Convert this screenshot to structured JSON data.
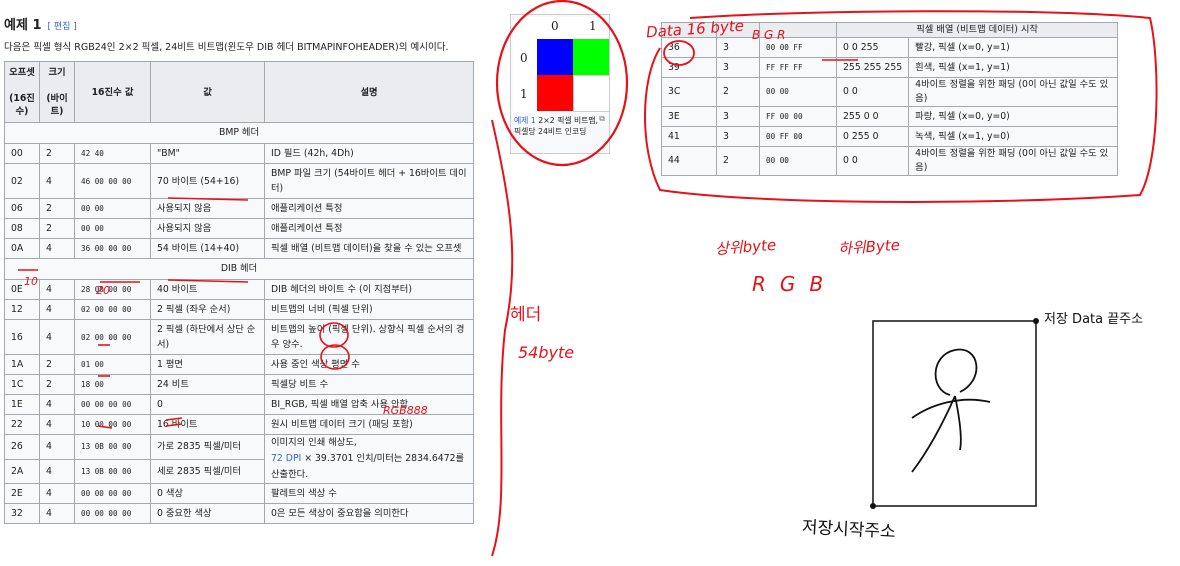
{
  "heading": {
    "title": "예제 1",
    "edit": "[ 편집 ]"
  },
  "intro": "다음은 픽셀 형식 RGB24인 2×2 픽셀, 24비트 비트맵(윈도우 DIB 헤더 BITMAPINFOHEADER)의 예시이다.",
  "table": {
    "headers": [
      "오프셋\n(16진수)",
      "크기\n(바이트)",
      "16진수 값",
      "값",
      "설명"
    ],
    "section_bmp": "BMP 헤더",
    "section_dib": "DIB 헤더",
    "bmp_rows": [
      [
        "00",
        "2",
        "42 40",
        "\"BM\"",
        "ID 필드 (42h, 4Dh)"
      ],
      [
        "02",
        "4",
        "46 00 00 00",
        "70 바이트 (54+16)",
        "BMP 파일 크기 (54바이트 헤더 + 16바이트 데이터)"
      ],
      [
        "06",
        "2",
        "00 00",
        "사용되지 않음",
        "애플리케이션 특정"
      ],
      [
        "08",
        "2",
        "00 00",
        "사용되지 않음",
        "애플리케이션 특정"
      ],
      [
        "0A",
        "4",
        "36 00 00 00",
        "54 바이트 (14+40)",
        "픽셀 배열 (비트맵 데이터)을 찾을 수 있는 오프셋"
      ]
    ],
    "dib_rows": [
      [
        "0E",
        "4",
        "28 00 00 00",
        "40 바이트",
        "DIB 헤더의 바이트 수 (이 지점부터)"
      ],
      [
        "12",
        "4",
        "02 00 00 00",
        "2 픽셀 (좌우 순서)",
        "비트맵의 너비 (픽셀 단위)"
      ],
      [
        "16",
        "4",
        "02 00 00 00",
        "2 픽셀 (하단에서 상단 순서)",
        "비트맵의 높이 (픽셀 단위). 상향식 픽셀 순서의 경우 양수."
      ],
      [
        "1A",
        "2",
        "01 00",
        "1 평면",
        "사용 중인 색상 평면 수"
      ],
      [
        "1C",
        "2",
        "18 00",
        "24 비트",
        "픽셀당 비트 수"
      ],
      [
        "1E",
        "4",
        "00 00 00 00",
        "0",
        "BI_RGB, 픽셀 배열 압축 사용 안함"
      ],
      [
        "22",
        "4",
        "10 00 00 00",
        "16 바이트",
        "원시 비트맵 데이터 크기 (패딩 포함)"
      ],
      [
        "26",
        "4",
        "13 0B 00 00",
        "가로 2835 픽셀/미터",
        ""
      ],
      [
        "2A",
        "4",
        "13 0B 00 00",
        "세로 2835 픽셀/미터",
        ""
      ],
      [
        "2E",
        "4",
        "00 00 00 00",
        "0 색상",
        "팔레트의 색상 수"
      ],
      [
        "32",
        "4",
        "00 00 00 00",
        "0 중요한 색상",
        "0은 모든 색상이 중요함을 의미한다"
      ]
    ],
    "resolution_desc_a": "이미지의 인쇄 해상도,",
    "resolution_link": "72 DPI",
    "resolution_desc_b": " × 39.3701 인치/미터는 2834.6472를 산출한다."
  },
  "figure": {
    "col_labels": [
      "0",
      "1"
    ],
    "row_labels": [
      "0",
      "1"
    ],
    "colors": [
      "#0000ff",
      "#00ff00",
      "#ff0000",
      "#ffffff"
    ],
    "caption_link": "예제 1",
    "caption_text": " 2×2 픽셀 비트맵, 픽셀당 24비트 인코딩"
  },
  "right_table": {
    "header": "픽셀 배열 (비트맵 데이터) 시작",
    "rows": [
      [
        "36",
        "3",
        "00 00 FF",
        "0 0 255",
        "빨강, 픽셀 (x=0, y=1)"
      ],
      [
        "39",
        "3",
        "FF FF FF",
        "255 255 255",
        "흰색, 픽셀 (x=1, y=1)"
      ],
      [
        "3C",
        "2",
        "00 00",
        "0 0",
        "4바이트 정렬을 위한 패딩 (0이 아닌 값일 수도 있음)"
      ],
      [
        "3E",
        "3",
        "FF 00 00",
        "255 0 0",
        "파랑, 픽셀 (x=0, y=0)"
      ],
      [
        "41",
        "3",
        "00 FF 00",
        "0 255 0",
        "녹색, 픽셀 (x=1, y=0)"
      ],
      [
        "44",
        "2",
        "00 00",
        "0 0",
        "4바이트 정렬을 위한 패딩 (0이 아닌 값일 수도 있음)"
      ]
    ]
  },
  "annotations": {
    "data_16byte": "Data 16 byte",
    "bgr": "B G R",
    "header_54": "헤더",
    "byte_54": "54byte",
    "upper_byte": "상위byte",
    "lower_byte": "하위Byte",
    "rgb": "RGB",
    "rgb888": "RGB888",
    "ten": "10",
    "twenty": "20",
    "save_end": "저장 Data 끝주소",
    "save_start": "저장시작주소"
  }
}
